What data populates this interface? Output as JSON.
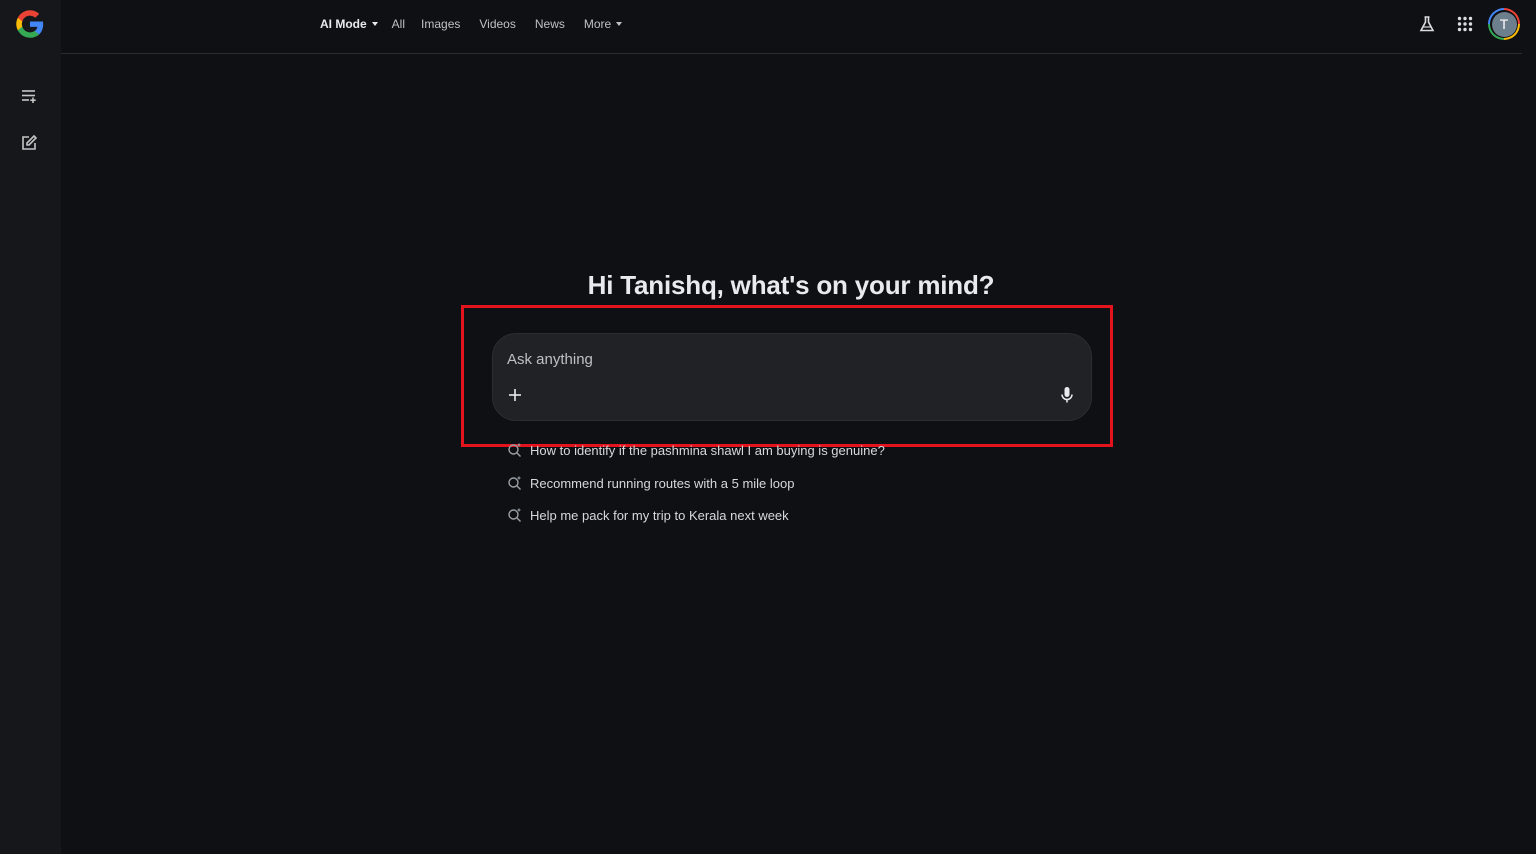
{
  "nav": {
    "items": [
      {
        "label": "AI Mode",
        "active": true,
        "dropdown": true
      },
      {
        "label": "All"
      },
      {
        "label": "Images"
      },
      {
        "label": "Videos"
      },
      {
        "label": "News"
      },
      {
        "label": "More",
        "dropdown": true
      }
    ]
  },
  "sidebar": {
    "icons": [
      "history-icon",
      "new-chat-icon"
    ]
  },
  "header": {
    "icons": [
      "labs-flask-icon",
      "apps-grid-icon"
    ],
    "avatar_initial": "T"
  },
  "main": {
    "greeting": "Hi Tanishq, what's on your mind?",
    "search": {
      "placeholder": "Ask anything",
      "value": ""
    },
    "suggestions": [
      "How to identify if the pashmina shawl I am buying is genuine?",
      "Recommend running routes with a 5 mile loop",
      "Help me pack for my trip to Kerala next week"
    ]
  },
  "colors": {
    "background": "#0f1013",
    "sidebar": "#16171b",
    "searchbox": "#212225",
    "highlight": "#e3141d"
  }
}
